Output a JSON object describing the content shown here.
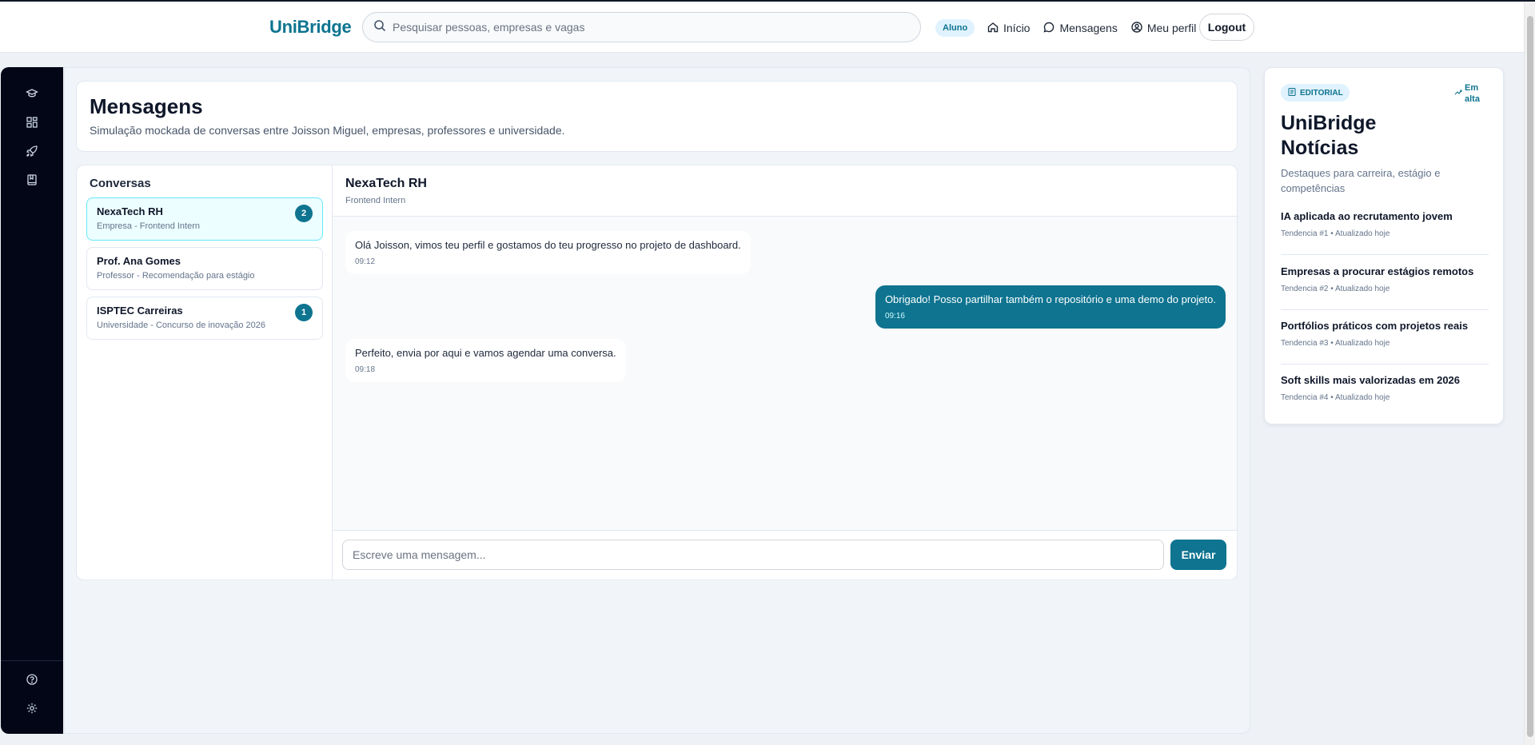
{
  "app": {
    "brand": "UniBridge"
  },
  "header": {
    "search_placeholder": "Pesquisar pessoas, empresas e vagas",
    "role_badge": "Aluno",
    "nav": [
      {
        "label": "Início",
        "icon": "home-icon"
      },
      {
        "label": "Mensagens",
        "icon": "message-icon"
      },
      {
        "label": "Meu perfil",
        "icon": "user-circle-icon"
      }
    ],
    "logout_label": "Logout"
  },
  "sidebar": {
    "top_icons": [
      "graduation-cap-icon",
      "grid-icon",
      "rocket-icon",
      "book-icon"
    ],
    "bottom_icons": [
      "help-icon",
      "settings-icon"
    ]
  },
  "page": {
    "title": "Mensagens",
    "subtitle": "Simulação mockada de conversas entre Joisson Miguel, empresas, professores e universidade."
  },
  "conversations": {
    "title": "Conversas",
    "items": [
      {
        "name": "NexaTech RH",
        "meta": "Empresa - Frontend Intern",
        "badge": "2",
        "active": true
      },
      {
        "name": "Prof. Ana Gomes",
        "meta": "Professor - Recomendação para estágio",
        "badge": "",
        "active": false
      },
      {
        "name": "ISPTEC Carreiras",
        "meta": "Universidade - Concurso de inovação 2026",
        "badge": "1",
        "active": false
      }
    ]
  },
  "thread": {
    "name": "NexaTech RH",
    "subtitle": "Frontend Intern",
    "messages": [
      {
        "text": "Olá Joisson, vimos teu perfil e gostamos do teu progresso no projeto de dashboard.",
        "time": "09:12",
        "direction": "in"
      },
      {
        "text": "Obrigado! Posso partilhar também o repositório e uma demo do projeto.",
        "time": "09:16",
        "direction": "out"
      },
      {
        "text": "Perfeito, envia por aqui e vamos agendar uma conversa.",
        "time": "09:18",
        "direction": "in"
      }
    ],
    "composer_placeholder": "Escreve uma mensagem...",
    "send_label": "Enviar"
  },
  "news": {
    "badge": "EDITORIAL",
    "trend_label": "Em alta",
    "title": "UniBridge Notícias",
    "subtitle": "Destaques para carreira, estágio e competências",
    "items": [
      {
        "title": "IA aplicada ao recrutamento jovem",
        "meta": "Tendencia #1 • Atualizado hoje"
      },
      {
        "title": "Empresas a procurar estágios remotos",
        "meta": "Tendencia #2 • Atualizado hoje"
      },
      {
        "title": "Portfólios práticos com projetos reais",
        "meta": "Tendencia #3 • Atualizado hoje"
      },
      {
        "title": "Soft skills mais valorizadas em 2026",
        "meta": "Tendencia #4 • Atualizado hoje"
      }
    ]
  },
  "colors": {
    "brand": "#0e7490",
    "sidebar_bg": "#020617",
    "active_conversation_bg": "#ecfeff",
    "outgoing_bubble": "#0e7490"
  }
}
